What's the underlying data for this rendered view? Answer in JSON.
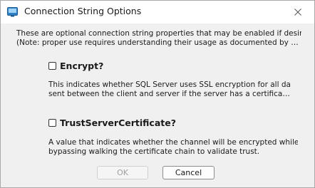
{
  "window": {
    "title": "Connection String Options",
    "icon": "connection-icon",
    "close_icon": "close-icon"
  },
  "intro": {
    "line1": "These are optional connection string properties that may be enabled if desired",
    "line2": "(Note: proper use requires understanding their usage as documented by SQL Se..."
  },
  "options": [
    {
      "label": "Encrypt?",
      "checked": false,
      "description_line1": "This indicates whether SQL Server uses SSL encryption for all data",
      "description_line2": "sent between the client and server if the server has a certificate in..."
    },
    {
      "label": "TrustServerCertificate?",
      "checked": false,
      "description_line1": "A value that indicates whether the channel will be encrypted while",
      "description_line2": "bypassing walking the certificate chain to validate trust."
    }
  ],
  "buttons": {
    "ok_label": "OK",
    "ok_enabled": false,
    "cancel_label": "Cancel"
  },
  "colors": {
    "dialog_background": "#f0f0f0",
    "titlebar_background": "#ffffff",
    "disabled_text": "#a0a0a0"
  }
}
